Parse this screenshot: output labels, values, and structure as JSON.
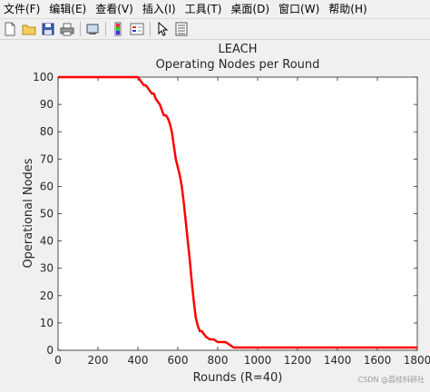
{
  "menu": {
    "items": [
      {
        "label": "文件(F)"
      },
      {
        "label": "编辑(E)"
      },
      {
        "label": "查看(V)"
      },
      {
        "label": "插入(I)"
      },
      {
        "label": "工具(T)"
      },
      {
        "label": "桌面(D)"
      },
      {
        "label": "窗口(W)"
      },
      {
        "label": "帮助(H)"
      }
    ]
  },
  "toolbar": {
    "icons": [
      "new-file-icon",
      "open-folder-icon",
      "save-icon",
      "print-icon",
      "link-plot-icon",
      "colorbar-icon",
      "legend-icon",
      "pointer-icon",
      "property-editor-icon"
    ]
  },
  "watermark": "CSDN @荔枝科研社",
  "chart_data": {
    "type": "line",
    "title": "LEACH",
    "subtitle": "Operating Nodes per Round",
    "xlabel": "Rounds (R=40)",
    "ylabel": "Operational Nodes",
    "xlim": [
      0,
      1800
    ],
    "ylim": [
      0,
      100
    ],
    "xticks": [
      0,
      200,
      400,
      600,
      800,
      1000,
      1200,
      1400,
      1600,
      1800
    ],
    "yticks": [
      0,
      10,
      20,
      30,
      40,
      50,
      60,
      70,
      80,
      90,
      100
    ],
    "grid": false,
    "line_color": "#ff0000",
    "series": [
      {
        "x": [
          0,
          400,
          410,
          420,
          430,
          440,
          450,
          460,
          470,
          480,
          490,
          500,
          510,
          520,
          530,
          540,
          550,
          560,
          570,
          580,
          590,
          600,
          610,
          620,
          630,
          640,
          650,
          660,
          670,
          680,
          690,
          700,
          710,
          720,
          730,
          740,
          760,
          780,
          800,
          820,
          840,
          860,
          880,
          900,
          1000,
          1200,
          1400,
          1600,
          1800
        ],
        "y": [
          100,
          100,
          99,
          98,
          97,
          97,
          96,
          95,
          94,
          94,
          92,
          91,
          90,
          88,
          86,
          86,
          85,
          83,
          80,
          75,
          70,
          67,
          64,
          60,
          54,
          47,
          40,
          33,
          25,
          18,
          12,
          9,
          7,
          7,
          6,
          5,
          4,
          4,
          3,
          3,
          3,
          2,
          1,
          1,
          1,
          1,
          1,
          1,
          1
        ]
      }
    ]
  }
}
